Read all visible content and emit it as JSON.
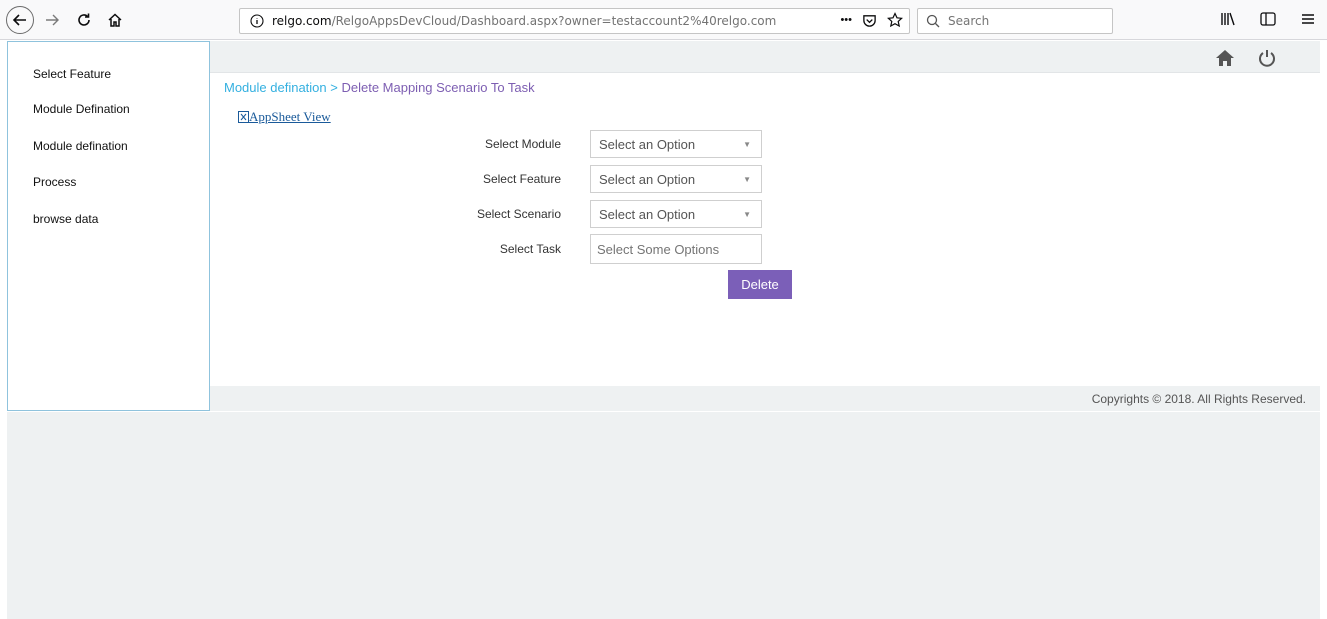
{
  "browser": {
    "url_prefix": "relgo.com",
    "url_rest": "/RelgoAppsDevCloud/Dashboard.aspx?owner=testaccount2%40relgo.com",
    "search_placeholder": "Search",
    "more_glyph": "•••"
  },
  "sidebar": {
    "items": [
      {
        "label": "Select Feature"
      },
      {
        "label": "Module Defination"
      },
      {
        "label": "Module defination"
      },
      {
        "label": "Process"
      },
      {
        "label": "browse data"
      }
    ]
  },
  "breadcrumb": {
    "parent": "Module defination",
    "separator": " > ",
    "current": "Delete Mapping Scenario To Task"
  },
  "appsheet_link": "AppSheet View",
  "form": {
    "module": {
      "label": "Select Module",
      "value": "Select an Option"
    },
    "feature": {
      "label": "Select Feature",
      "value": "Select an Option"
    },
    "scenario": {
      "label": "Select Scenario",
      "value": "Select an Option"
    },
    "task": {
      "label": "Select Task",
      "placeholder": "Select Some Options"
    },
    "delete_label": "Delete"
  },
  "footer": {
    "copyright": "Copyrights © 2018. All Rights Reserved."
  },
  "colors": {
    "accent": "#7b5fb8",
    "breadcrumb_link": "#34b0e0",
    "breadcrumb_current": "#7d5eb2"
  }
}
